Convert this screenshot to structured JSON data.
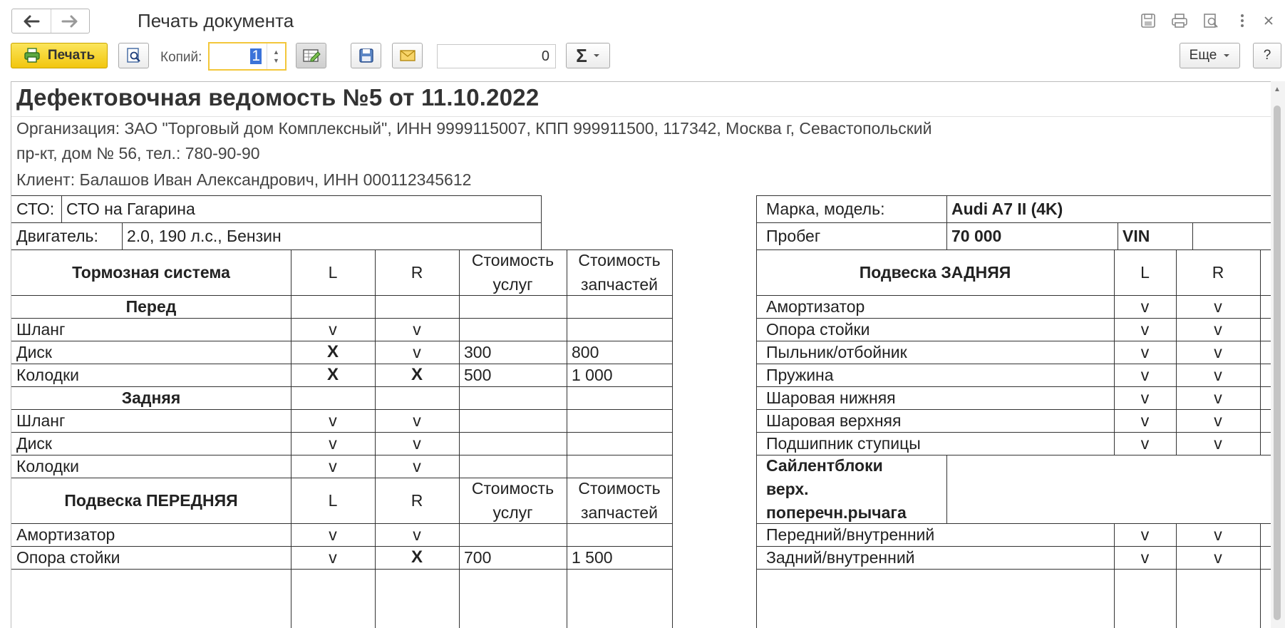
{
  "window": {
    "title": "Печать документа"
  },
  "toolbar": {
    "print_label": "Печать",
    "copies_label": "Копий:",
    "copies_value": "1",
    "sum_value": "0",
    "more_label": "Еще",
    "help_label": "?",
    "sum_symbol": "Σ"
  },
  "document": {
    "title": "Дефектовочная ведомость №5 от 11.10.2022",
    "org_line1": "Организация: ЗАО \"Торговый дом Комплексный\", ИНН 9999115007, КПП 999911500, 117342, Москва г, Севастопольский",
    "org_line2": "пр-кт, дом № 56, тел.: 780-90-90",
    "client_line": "Клиент: Балашов Иван Александрович, ИНН 000112345612",
    "sto_label": "СТО:",
    "sto_value": "СТО на Гагарина",
    "engine_label": "Двигатель:",
    "engine_value": "2.0, 190 л.с., Бензин",
    "brand_label": "Марка, модель:",
    "brand_value": "Audi A7 II (4K)",
    "mileage_label": "Пробег",
    "mileage_value": "70 000",
    "vin_label": "VIN",
    "left_table": {
      "brakes_header": "Тормозная система",
      "col_l": "L",
      "col_r": "R",
      "col_services": "Стоимость услуг",
      "col_parts": "Стоимость запчастей",
      "front_header": "Перед",
      "rear_header": "Задняя",
      "front_rows": [
        {
          "name": "Шланг",
          "l": "v",
          "r": "v",
          "s": "",
          "p": ""
        },
        {
          "name": "Диск",
          "l": "X",
          "r": "v",
          "s": "300",
          "p": "800"
        },
        {
          "name": "Колодки",
          "l": "X",
          "r": "X",
          "s": "500",
          "p": "1 000"
        }
      ],
      "rear_rows": [
        {
          "name": "Шланг",
          "l": "v",
          "r": "v",
          "s": "",
          "p": ""
        },
        {
          "name": "Диск",
          "l": "v",
          "r": "v",
          "s": "",
          "p": ""
        },
        {
          "name": "Колодки",
          "l": "v",
          "r": "v",
          "s": "",
          "p": ""
        }
      ],
      "susp_front_header": "Подвеска ПЕРЕДНЯЯ",
      "susp_front_rows": [
        {
          "name": "Амортизатор",
          "l": "v",
          "r": "v",
          "s": "",
          "p": ""
        },
        {
          "name": "Опора стойки",
          "l": "v",
          "r": "X",
          "s": "700",
          "p": "1 500"
        }
      ]
    },
    "right_table": {
      "header": "Подвеска ЗАДНЯЯ",
      "col_l": "L",
      "col_r": "R",
      "rows": [
        {
          "name": "Амортизатор",
          "l": "v",
          "r": "v"
        },
        {
          "name": "Опора стойки",
          "l": "v",
          "r": "v"
        },
        {
          "name": "Пыльник/отбойник",
          "l": "v",
          "r": "v"
        },
        {
          "name": "Пружина",
          "l": "v",
          "r": "v"
        },
        {
          "name": "Шаровая нижняя",
          "l": "v",
          "r": "v"
        },
        {
          "name": "Шаровая верхняя",
          "l": "v",
          "r": "v"
        },
        {
          "name": "Подшипник ступицы",
          "l": "v",
          "r": "v"
        }
      ],
      "silent_header": "Сайлентблоки верх. поперечн.рычага",
      "silent_rows": [
        {
          "name": "Передний/внутренний",
          "l": "v",
          "r": "v"
        },
        {
          "name": "Задний/внутренний",
          "l": "v",
          "r": "v"
        }
      ]
    }
  }
}
